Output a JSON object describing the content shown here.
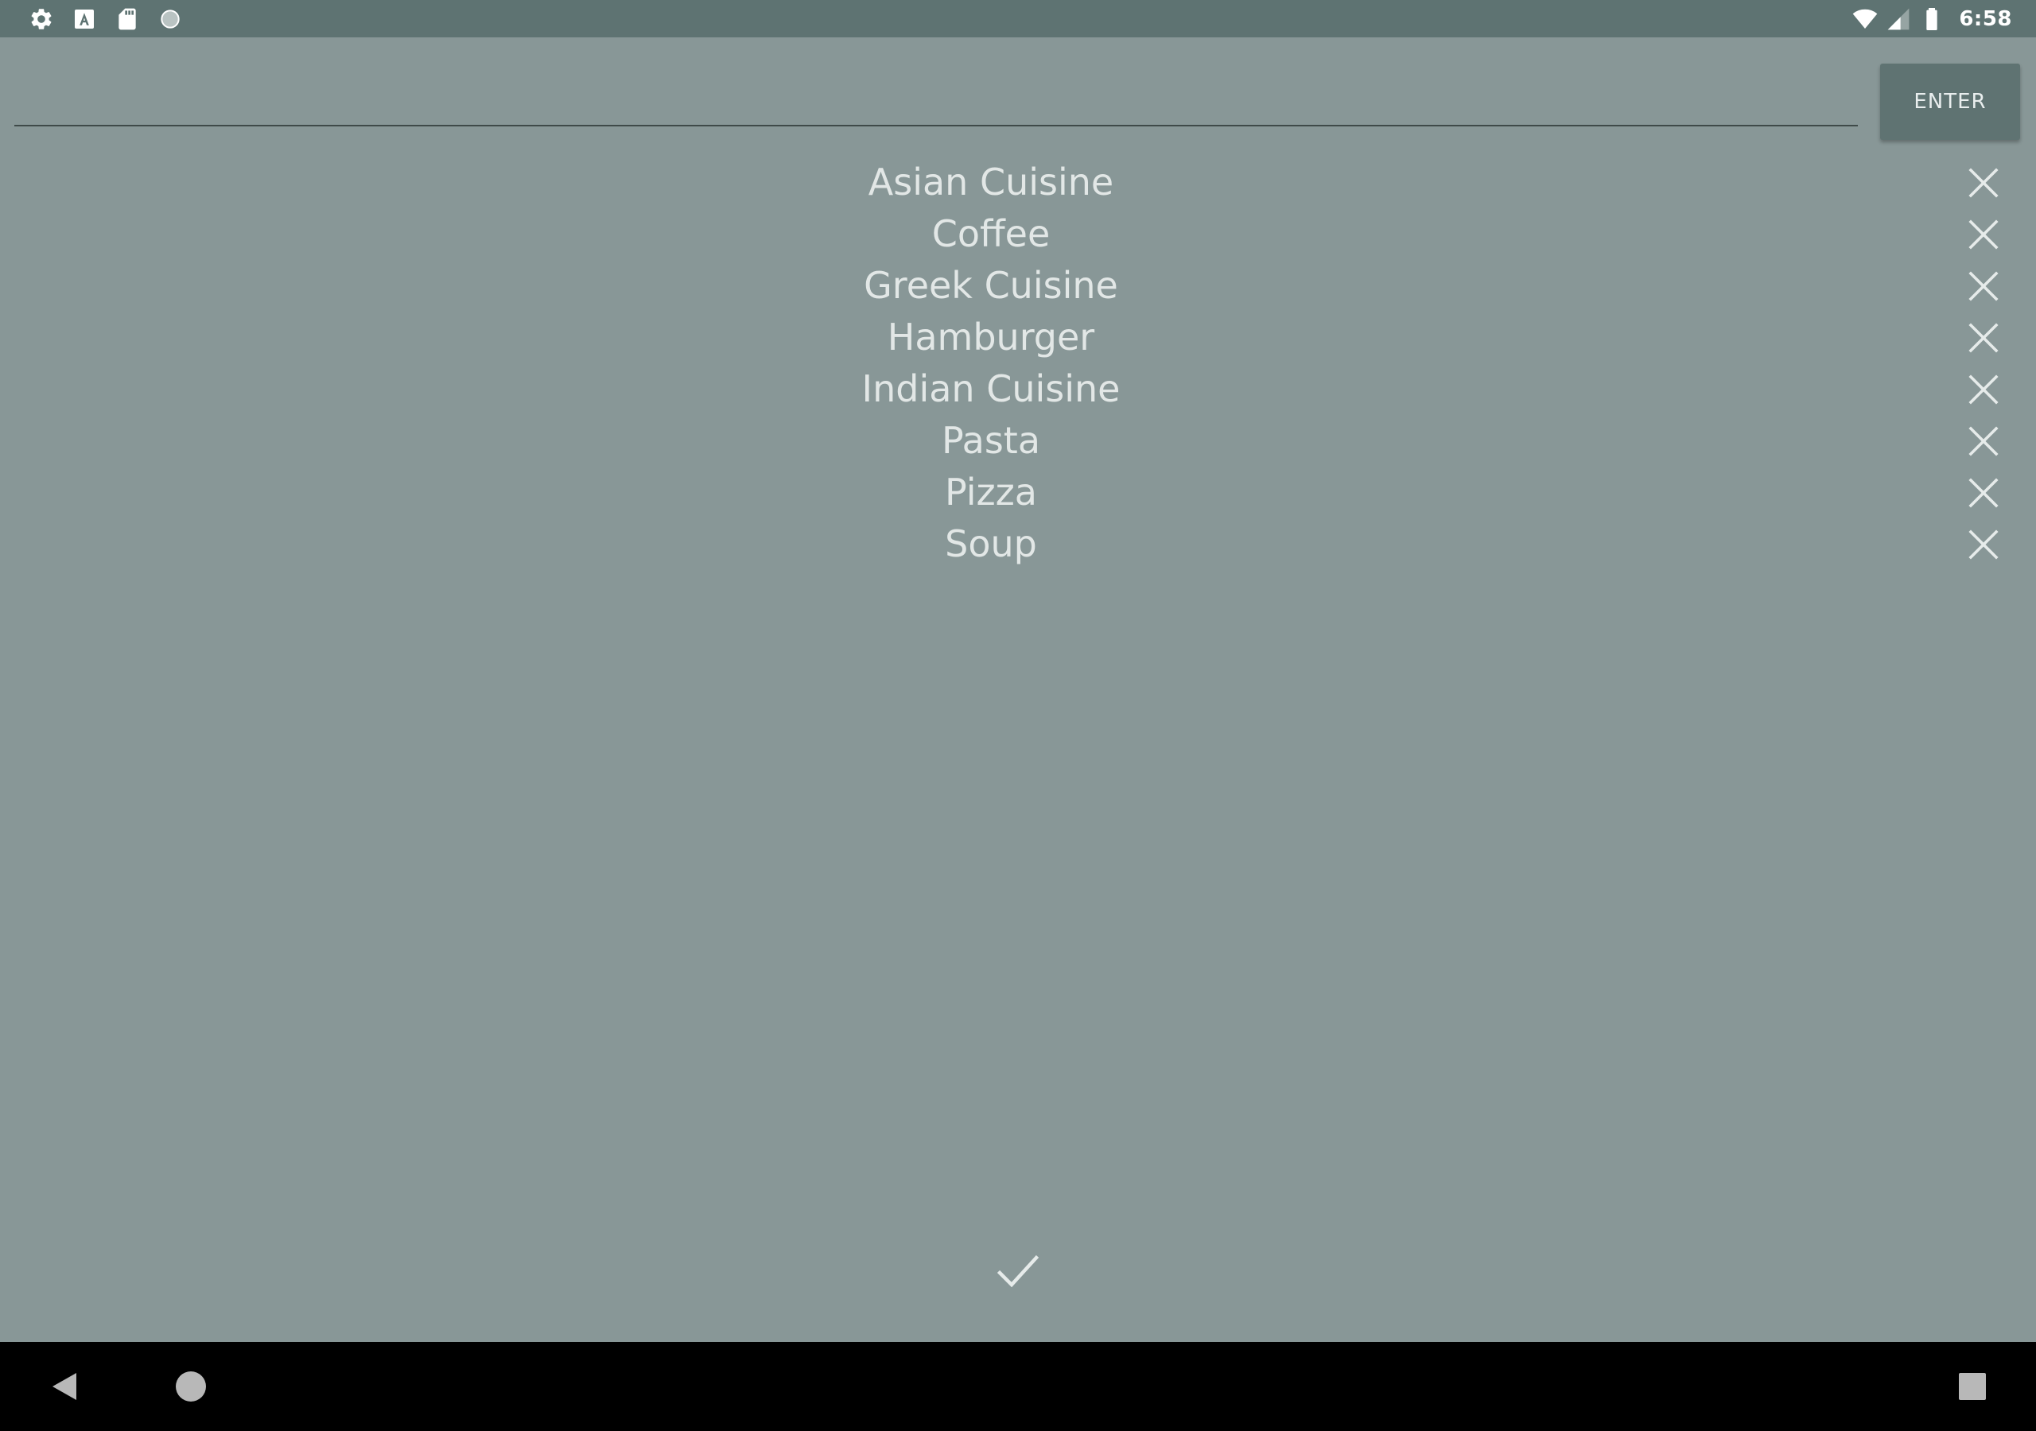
{
  "status_bar": {
    "left_icons": [
      "settings-icon",
      "keyboard-a-icon",
      "sd-card-icon",
      "circle-icon"
    ],
    "right_icons": [
      "wifi-icon",
      "signal-icon",
      "battery-icon"
    ],
    "time": "6:58"
  },
  "input": {
    "value": "",
    "placeholder": ""
  },
  "enter_button": {
    "label": "ENTER"
  },
  "items": [
    {
      "label": "Asian Cuisine"
    },
    {
      "label": "Coffee"
    },
    {
      "label": "Greek Cuisine"
    },
    {
      "label": "Hamburger"
    },
    {
      "label": "Indian Cuisine"
    },
    {
      "label": "Pasta"
    },
    {
      "label": "Pizza"
    },
    {
      "label": "Soup"
    }
  ],
  "remove_icon": "close-icon",
  "confirm_icon": "check-icon",
  "nav_bar": {
    "buttons": [
      "back-icon",
      "home-icon",
      "recents-icon"
    ]
  },
  "colors": {
    "background": "#889797",
    "status_bar": "#5e7372",
    "button": "#5f7372",
    "item_text": "#e2e7e6",
    "icon": "#e6ebea",
    "nav_bar": "#000000"
  }
}
